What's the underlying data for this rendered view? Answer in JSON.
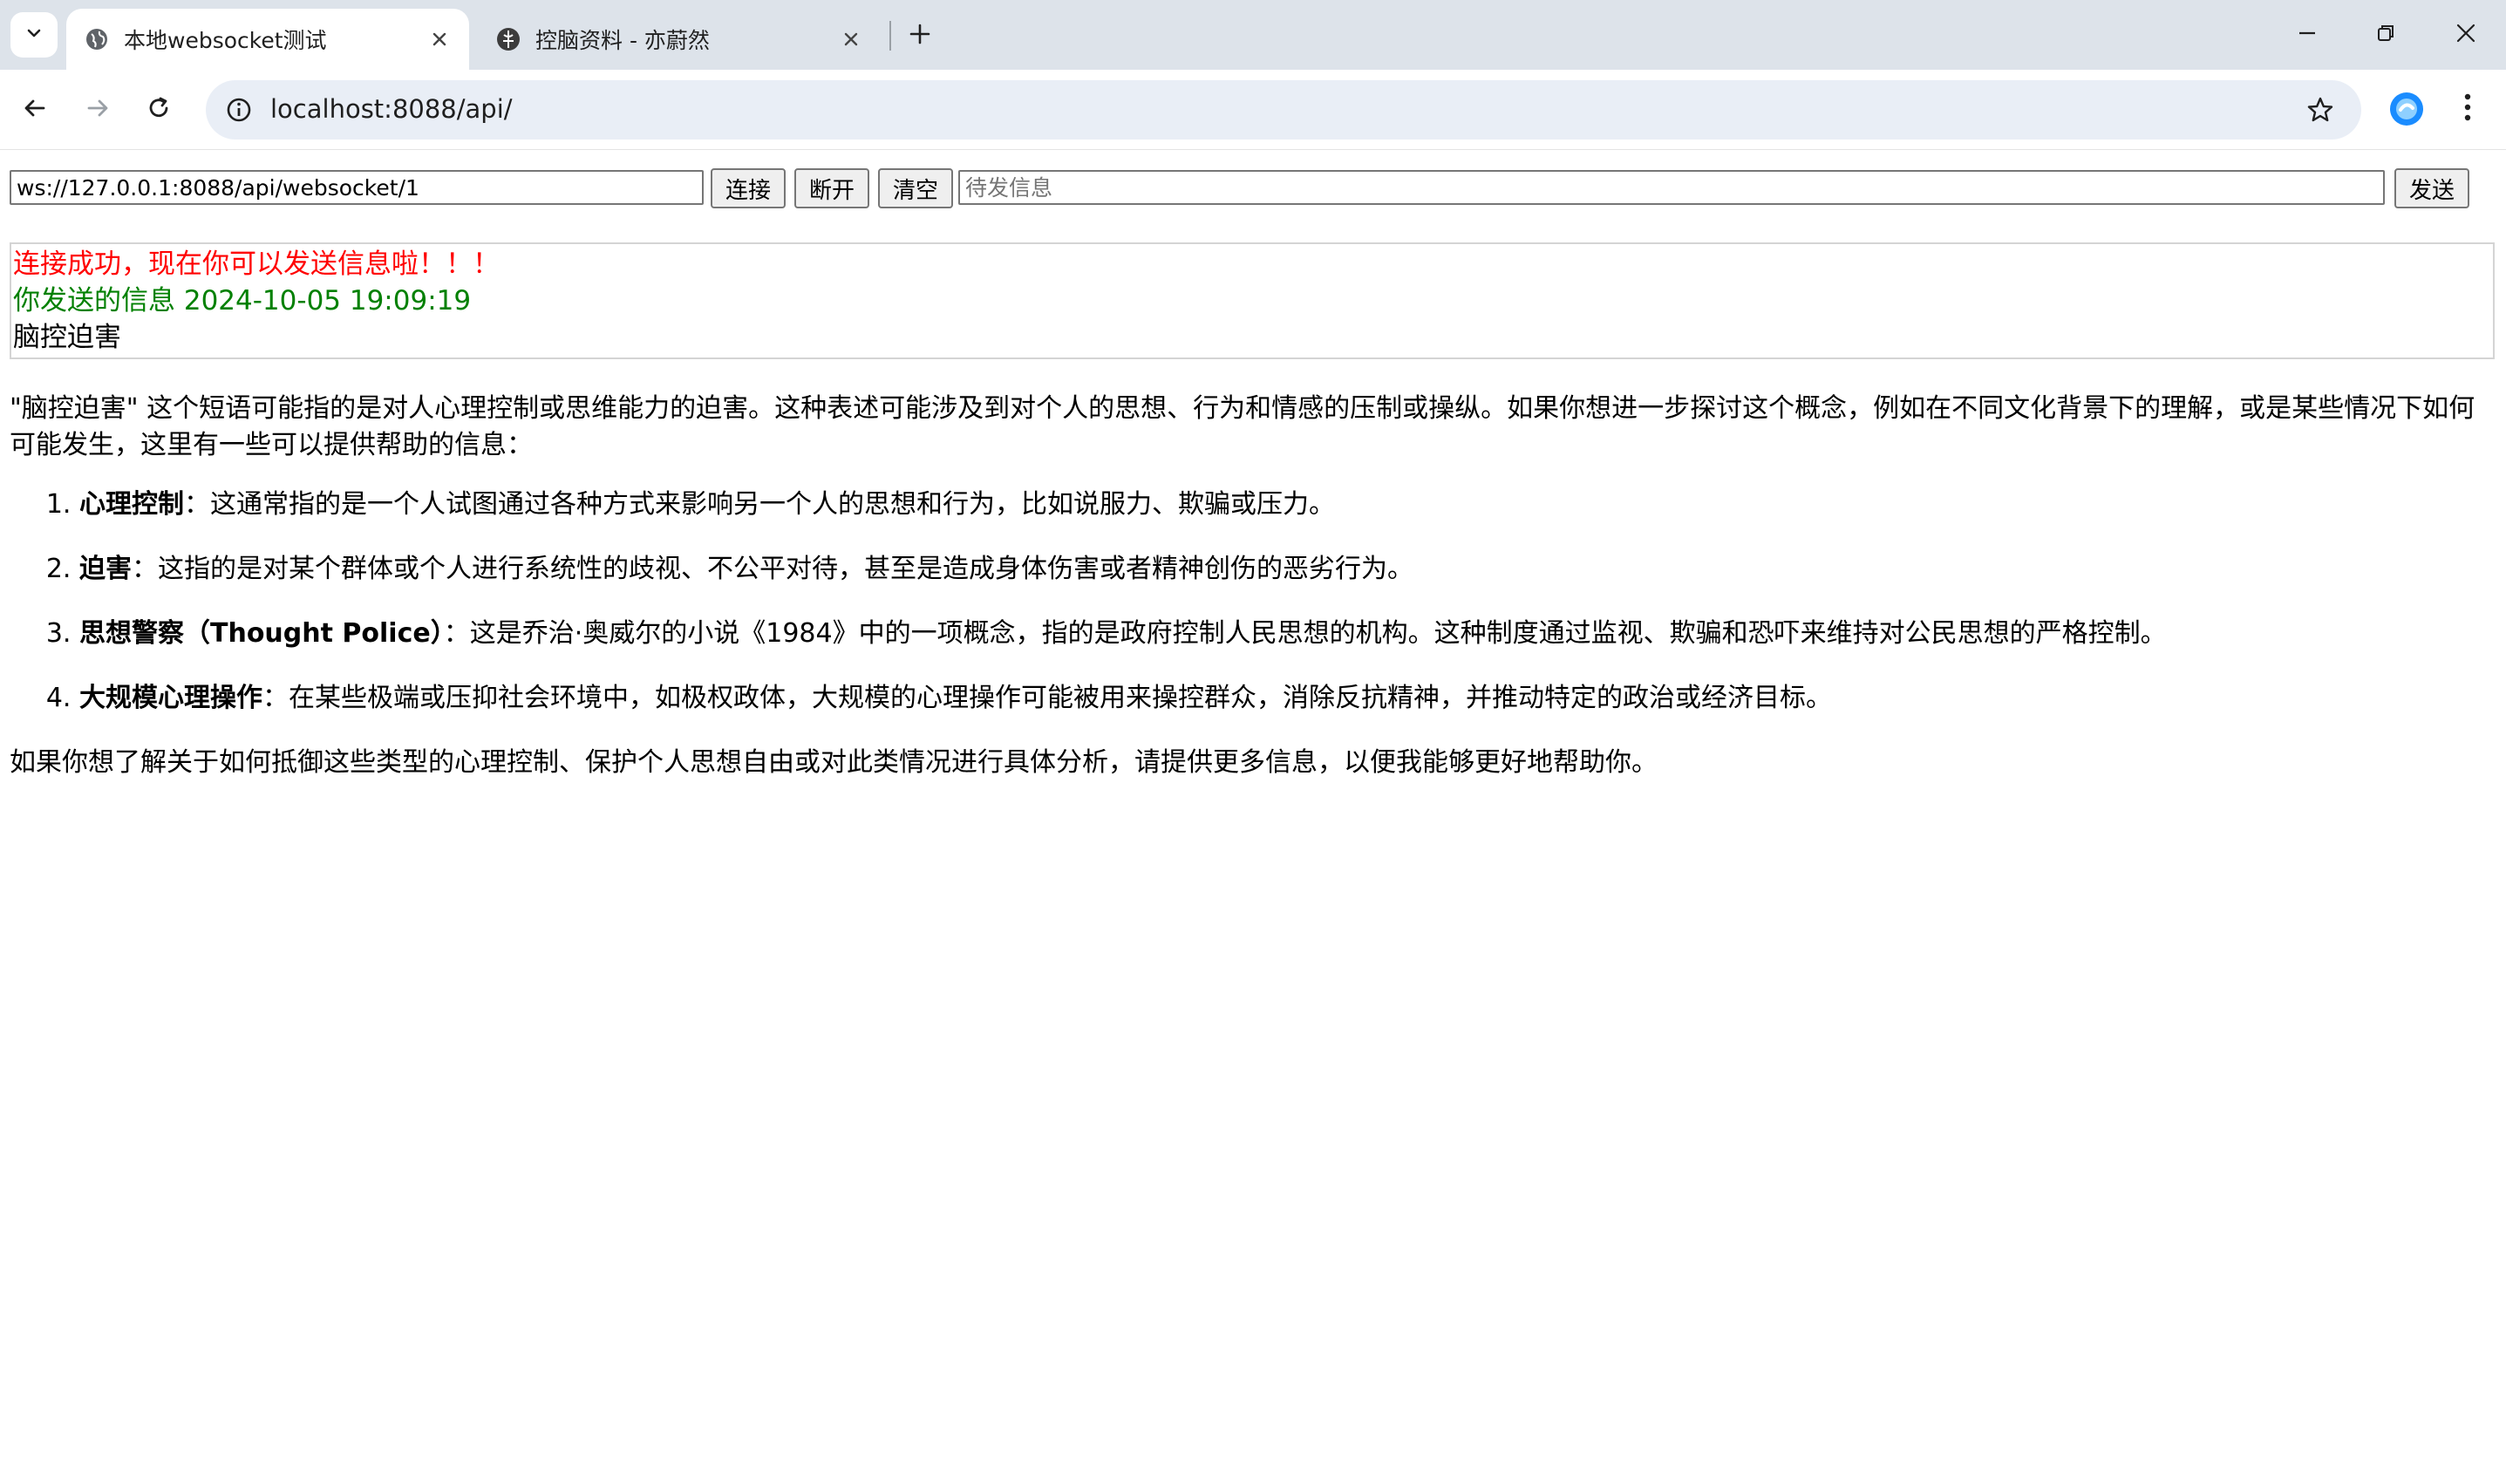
{
  "browser": {
    "tabs": [
      {
        "title": "本地websocket测试",
        "active": true
      },
      {
        "title": "控脑资料 - 亦蔚然",
        "active": false
      }
    ],
    "address": "localhost:8088/api/"
  },
  "controls": {
    "ws_url": "ws://127.0.0.1:8088/api/websocket/1",
    "connect_label": "连接",
    "disconnect_label": "断开",
    "clear_label": "清空",
    "message_placeholder": "待发信息",
    "send_label": "发送"
  },
  "log": {
    "connected": "连接成功，现在你可以发送信息啦！！！",
    "sent_header": "你发送的信息 2024-10-05 19:09:19",
    "sent_text": "脑控迫害"
  },
  "reply": {
    "intro": "\"脑控迫害\" 这个短语可能指的是对人心理控制或思维能力的迫害。这种表述可能涉及到对个人的思想、行为和情感的压制或操纵。如果你想进一步探讨这个概念，例如在不同文化背景下的理解，或是某些情况下如何可能发生，这里有一些可以提供帮助的信息：",
    "items": [
      {
        "term": "心理控制",
        "sep": "：",
        "text": "这通常指的是一个人试图通过各种方式来影响另一个人的思想和行为，比如说服力、欺骗或压力。"
      },
      {
        "term": "迫害",
        "sep": "：",
        "text": "这指的是对某个群体或个人进行系统性的歧视、不公平对待，甚至是造成身体伤害或者精神创伤的恶劣行为。"
      },
      {
        "term": "思想警察（Thought Police）",
        "sep": "：",
        "text": "这是乔治·奥威尔的小说《1984》中的一项概念，指的是政府控制人民思想的机构。这种制度通过监视、欺骗和恐吓来维持对公民思想的严格控制。"
      },
      {
        "term": "大规模心理操作",
        "sep": "：",
        "text": "在某些极端或压抑社会环境中，如极权政体，大规模的心理操作可能被用来操控群众，消除反抗精神，并推动特定的政治或经济目标。"
      }
    ],
    "outro": "如果你想了解关于如何抵御这些类型的心理控制、保护个人思想自由或对此类情况进行具体分析，请提供更多信息，以便我能够更好地帮助你。"
  },
  "colors": {
    "connected": "#ff0000",
    "sent": "#008000"
  }
}
